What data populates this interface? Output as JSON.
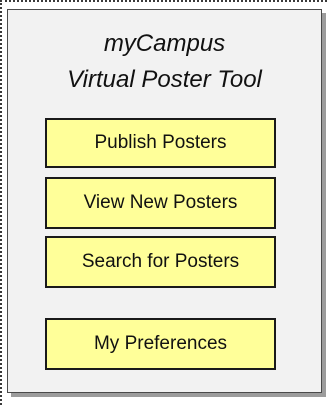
{
  "app": {
    "title_line1": "myCampus",
    "title_line2": "Virtual Poster Tool"
  },
  "menu": {
    "items": [
      {
        "label": "Publish Posters"
      },
      {
        "label": "View New Posters"
      },
      {
        "label": "Search for Posters"
      },
      {
        "label": "My Preferences"
      }
    ]
  },
  "colors": {
    "button_fill": "#ffff99",
    "panel_fill": "#f2f2f2",
    "border": "#1a1a1a"
  }
}
